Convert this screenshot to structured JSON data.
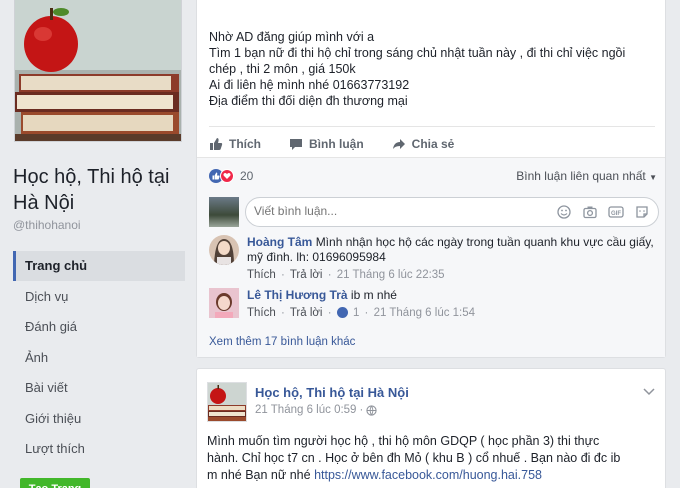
{
  "page": {
    "name": "Học hộ, Thi hộ tại Hà Nội",
    "handle": "@thihohanoi",
    "nav": [
      {
        "label": "Trang chủ",
        "active": true
      },
      {
        "label": "Dịch vụ"
      },
      {
        "label": "Đánh giá"
      },
      {
        "label": "Ảnh"
      },
      {
        "label": "Bài viết"
      },
      {
        "label": "Giới thiệu"
      },
      {
        "label": "Lượt thích"
      }
    ],
    "follow_button": "Tạo Trang"
  },
  "post1": {
    "lines": [
      "Nhờ AD đăng giúp mình với a",
      "Tìm 1 bạn nữ đi thi hộ chỉ trong sáng chủ nhật tuần này , đi thi chỉ việc ngồi",
      "chép , thi 2 môn , giá 150k",
      "Ai đi liên hệ mình nhé 01663773192",
      "Địa điểm thi đối diện đh thương mại"
    ],
    "actions": {
      "like": "Thích",
      "comment": "Bình luận",
      "share": "Chia sẻ"
    },
    "reaction_count": "20",
    "sort_label": "Bình luận liên quan nhất",
    "comment_placeholder": "Viết bình luận...",
    "comments": [
      {
        "name": "Hoàng Tâm",
        "text": "Mình nhận học hộ các ngày trong tuần quanh khu vực cầu giấy, mỹ đình. lh: 01696095984",
        "like": "Thích",
        "reply": "Trả lời",
        "time": "21 Tháng 6 lúc 22:35"
      },
      {
        "name": "Lê Thị Hương Trà",
        "text": "ib m nhé",
        "like": "Thích",
        "reply": "Trả lời",
        "likes": "1",
        "time": "21 Tháng 6 lúc 1:54"
      }
    ],
    "more_comments": "Xem thêm 17 bình luận khác"
  },
  "post2": {
    "author": "Học hộ, Thi hộ tại Hà Nội",
    "time": "21 Tháng 6 lúc 0:59",
    "text_lines": [
      "Mình muốn tìm người học hộ , thi hộ môn GDQP ( học phần 3) thi thực",
      "hành. Chỉ học t7 cn . Học ở bên đh Mỏ ( khu B ) cổ nhuế . Bạn nào đi đc ib",
      "m nhé Bạn nữ nhé "
    ],
    "link": "https://www.facebook.com/huong.hai.758"
  },
  "colors": {
    "brand": "#4267b2",
    "link": "#385898",
    "love": "#f0284a",
    "background": "#e9ebee"
  }
}
